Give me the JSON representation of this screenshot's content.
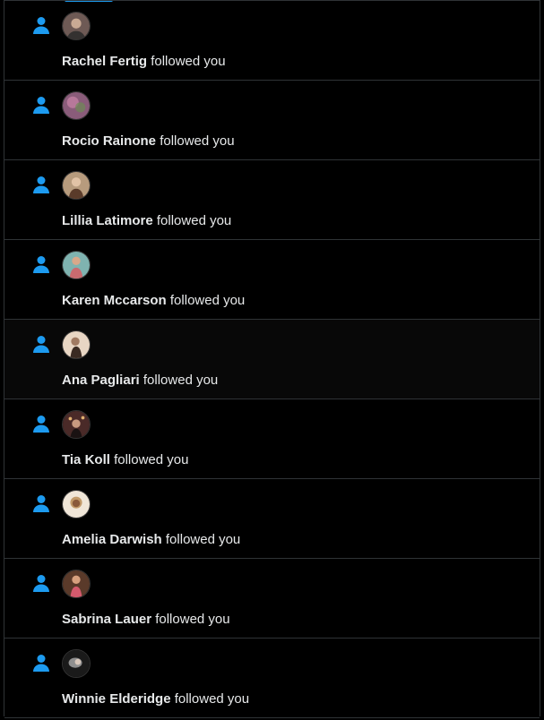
{
  "accent_color": "#1d9bf0",
  "notifications": [
    {
      "name": "Rachel Fertig",
      "action": "followed you",
      "icon": "person-follow-icon",
      "avatar_color": "#6e5a55"
    },
    {
      "name": "Rocio Rainone",
      "action": "followed you",
      "icon": "person-follow-icon",
      "avatar_color": "#8a5c7a"
    },
    {
      "name": "Lillia Latimore",
      "action": "followed you",
      "icon": "person-follow-icon",
      "avatar_color": "#b79b7d"
    },
    {
      "name": "Karen Mccarson",
      "action": "followed you",
      "icon": "person-follow-icon",
      "avatar_color": "#c96a6f"
    },
    {
      "name": "Ana Pagliari",
      "action": "followed you",
      "icon": "person-follow-icon",
      "avatar_color": "#a07a62"
    },
    {
      "name": "Tia Koll",
      "action": "followed you",
      "icon": "person-follow-icon",
      "avatar_color": "#4a2a28"
    },
    {
      "name": "Amelia Darwish",
      "action": "followed you",
      "icon": "person-follow-icon",
      "avatar_color": "#c29a6a"
    },
    {
      "name": "Sabrina Lauer",
      "action": "followed you",
      "icon": "person-follow-icon",
      "avatar_color": "#d45a6d"
    },
    {
      "name": "Winnie Elderidge",
      "action": "followed you",
      "icon": "person-follow-icon",
      "avatar_color": "#8f8f8f"
    }
  ]
}
